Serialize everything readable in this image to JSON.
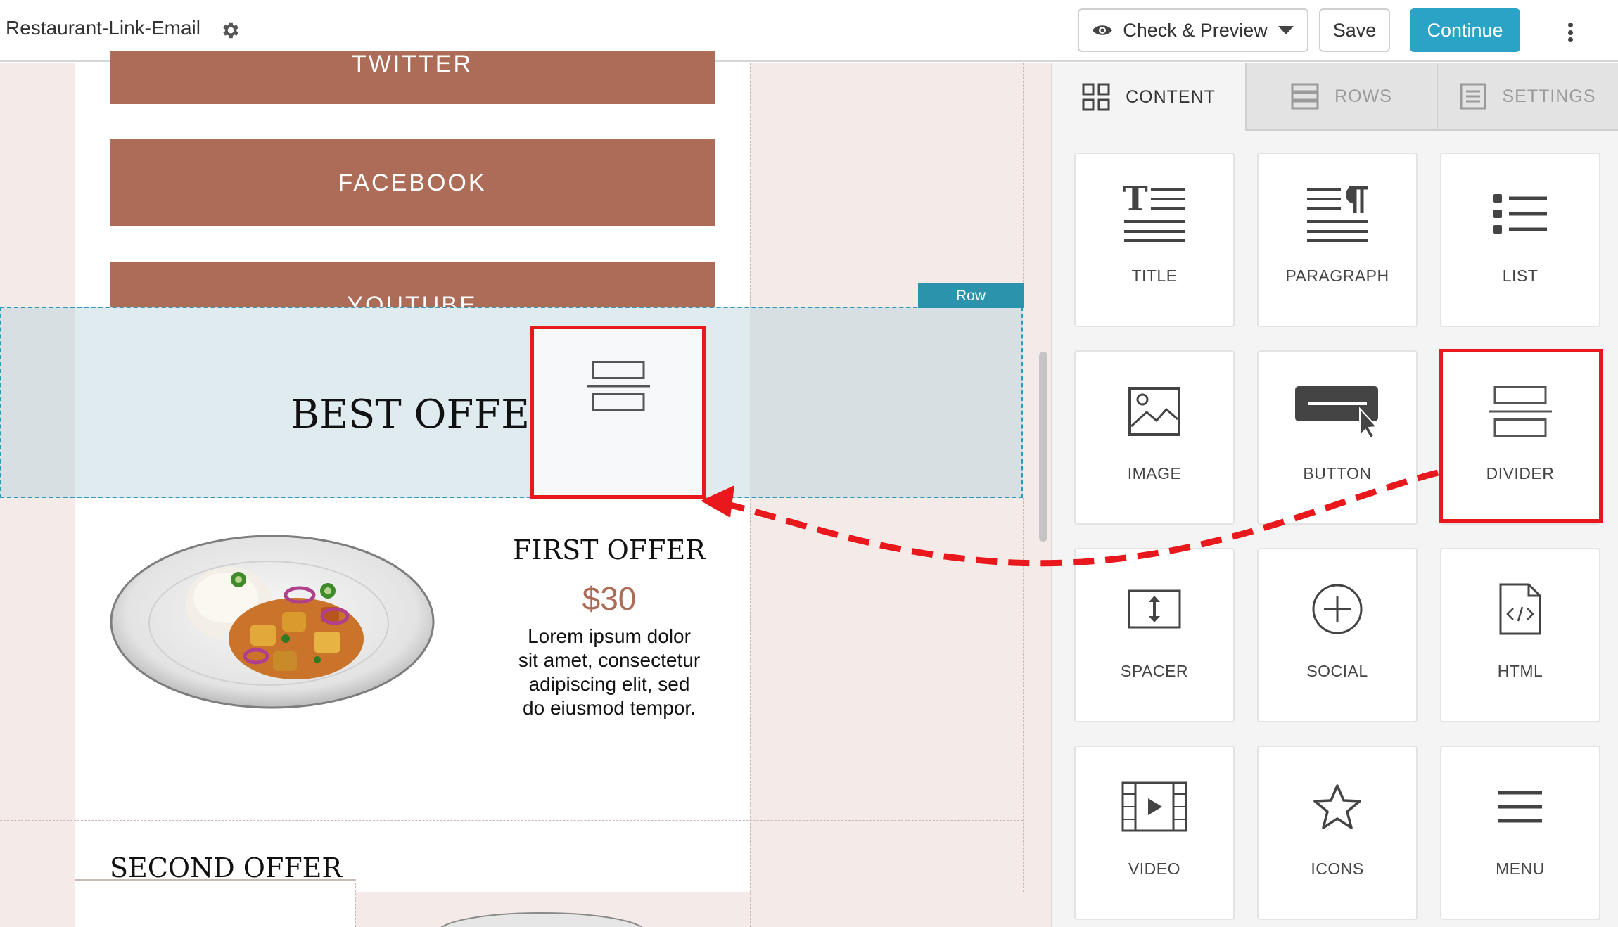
{
  "topbar": {
    "title": "Restaurant-Link-Email",
    "preview_label": "Check & Preview",
    "save_label": "Save",
    "continue_label": "Continue"
  },
  "canvas": {
    "buttons": [
      "TWITTER",
      "FACEBOOK",
      "YOUTUBE"
    ],
    "row_tag": "Row",
    "heading": "BEST OFFER",
    "offer_title": "FIRST OFFER",
    "offer_price": "$30",
    "offer_text_lines": [
      "Lorem ipsum dolor",
      "sit amet, consectetur",
      "adipiscing elit, sed",
      "do eiusmod tempor."
    ],
    "next_title": "SECOND OFFER"
  },
  "panel": {
    "tabs": [
      {
        "label": "CONTENT",
        "active": true
      },
      {
        "label": "ROWS",
        "active": false
      },
      {
        "label": "SETTINGS",
        "active": false
      }
    ],
    "tiles": [
      {
        "label": "TITLE",
        "icon": "title-icon"
      },
      {
        "label": "PARAGRAPH",
        "icon": "paragraph-icon"
      },
      {
        "label": "LIST",
        "icon": "list-icon"
      },
      {
        "label": "IMAGE",
        "icon": "image-icon"
      },
      {
        "label": "BUTTON",
        "icon": "button-icon"
      },
      {
        "label": "DIVIDER",
        "icon": "divider-icon"
      },
      {
        "label": "SPACER",
        "icon": "spacer-icon"
      },
      {
        "label": "SOCIAL",
        "icon": "social-icon"
      },
      {
        "label": "HTML",
        "icon": "html-icon"
      },
      {
        "label": "VIDEO",
        "icon": "video-icon"
      },
      {
        "label": "ICONS",
        "icon": "star-icon"
      },
      {
        "label": "MENU",
        "icon": "menu-icon"
      }
    ]
  },
  "colors": {
    "accent": "#2ba3c6",
    "social_button": "#ac6c57",
    "highlight": "#e8181c",
    "canvas_bg": "#f4ebe8"
  }
}
